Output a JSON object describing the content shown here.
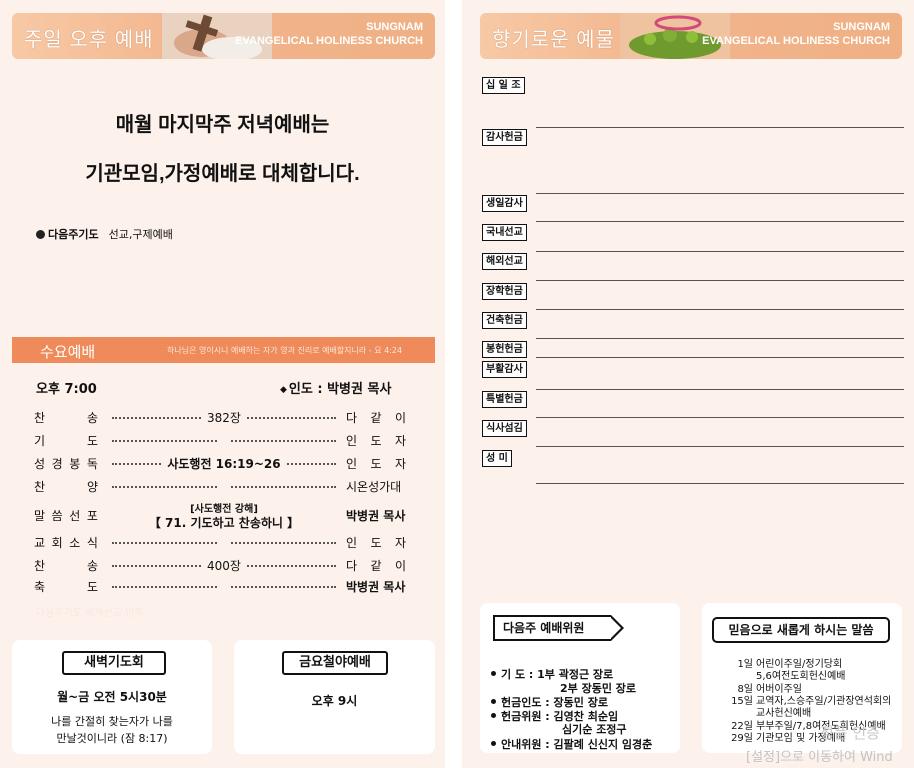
{
  "left": {
    "sunday_header": {
      "title": "주일 오후 예배",
      "church_line1": "SUNGNAM",
      "church_line2": "EVANGELICAL HOLINESS CHURCH"
    },
    "announcement_line1": "매월 마지막주 저녁예배는",
    "announcement_line2": "기관모임,가정예배로 대체합니다.",
    "next_prayer_label": "다음주기도",
    "next_prayer_value": "선교,구제예배",
    "wednesday": {
      "title": "수요예배",
      "verse": "하나님은 영이시니 예배하는 자가 영과 진리로 예배할지니라 - 요 4:24",
      "time": "오후 7:00",
      "lead": "인도 : 박병권 목사"
    },
    "order": [
      {
        "name": "찬송",
        "middle": "382장",
        "right": "다같이"
      },
      {
        "name": "기도",
        "middle": "",
        "right": "인도자"
      },
      {
        "name": "성경봉독",
        "middle": "사도행전 16:19~26",
        "right": "인도자"
      },
      {
        "name": "찬양",
        "middle": "",
        "right": "시온성가대"
      },
      {
        "name": "말씀선포",
        "middle": "",
        "right": "박병권 목사"
      },
      {
        "name": "교회소식",
        "middle": "",
        "right": "인도자"
      },
      {
        "name": "찬송",
        "middle": "400장",
        "right": "다같이"
      },
      {
        "name": "축도",
        "middle": "",
        "right": "박병권 목사"
      }
    ],
    "sermon_ref": "[사도행전 강해]",
    "sermon_title": "【 71. 기도하고 찬송하니 】",
    "faded_text": "다음주기도    세계선교,민족",
    "dawn": {
      "title": "새벽기도회",
      "time": "월~금 오전 5시30분",
      "verse1": "나를 간절히 찾는자가 나를",
      "verse2": "만날것이니라 (잠 8:17)"
    },
    "friday": {
      "title": "금요철야예배",
      "time": "오후 9시"
    }
  },
  "right": {
    "offering_header": {
      "title": "향기로운 예물",
      "church_line1": "SUNGNAM",
      "church_line2": "EVANGELICAL HOLINESS CHURCH"
    },
    "offerings": [
      "십 일 조",
      "감사헌금",
      "생일감사",
      "국내선교",
      "해외선교",
      "장학헌금",
      "건축헌금",
      "봉헌헌금",
      "부활감사",
      "특별헌금",
      "식사섬김",
      "성    미"
    ],
    "next_week": {
      "title": "다음주 예배위원",
      "prayer_label": "기    도 : ",
      "prayer1": "1부 곽정근 장로",
      "prayer2": "2부 장동민 장로",
      "offering_prayer": "헌금인도 : 장동민 장로",
      "offering_team1": "헌금위원 : 김영찬  최순임",
      "offering_team2": "심기순  조정구",
      "guide": "안내위원 : 김팔례 신신지 임경춘"
    },
    "verse_box": {
      "title": "믿음으로 새롭게 하시는 말씀",
      "items": [
        {
          "day": "1일",
          "text": "어린이주일/정기당회"
        },
        {
          "day": "",
          "text": "5,6여전도회헌신예배"
        },
        {
          "day": "8일",
          "text": "어버이주일"
        },
        {
          "day": "15일",
          "text": "교역자,스승주일/기관장연석회의"
        },
        {
          "day": "",
          "text": "교사헌신예배"
        },
        {
          "day": "22일",
          "text": "부부주일/7,8여전도회헌신예배"
        },
        {
          "day": "29일",
          "text": "기관모임 및 가정예배"
        }
      ]
    },
    "watermark1": "정품 인증",
    "watermark2": "[설정]으로 이동하여 Wind"
  }
}
